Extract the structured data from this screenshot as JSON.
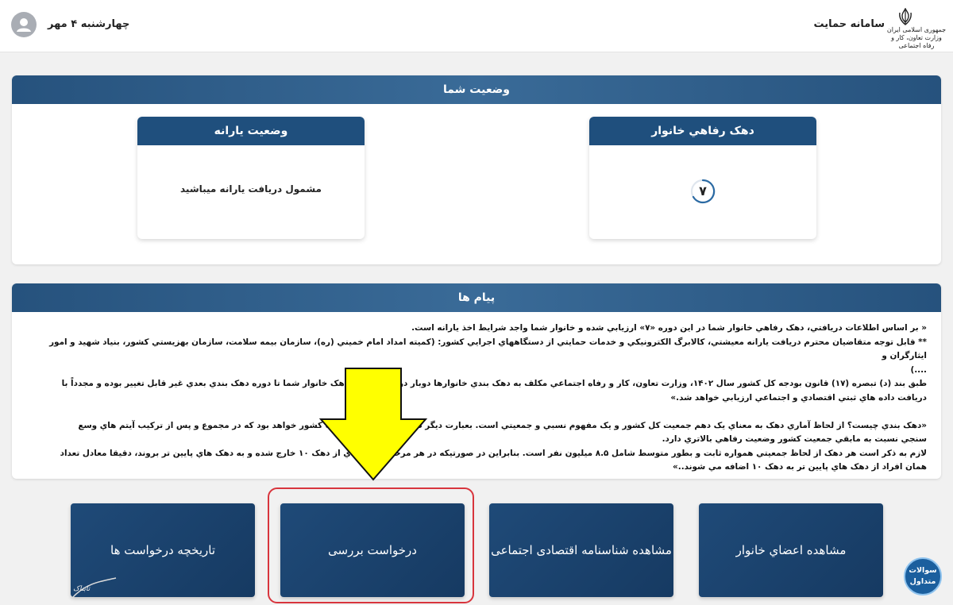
{
  "header": {
    "app_title": "سامانه حمايت",
    "ministry_lines": [
      "جمهوری اسلامی ایران",
      "وزارت تعاون، کار و رفاه اجتماعی"
    ],
    "date": "چهارشنبه ۴ مهر"
  },
  "status_panel": {
    "title": "وضعيت شما",
    "decile_card": {
      "title": "دهک رفاهي خانوار",
      "value": "۷"
    },
    "subsidy_card": {
      "title": "وضعيت يارانه",
      "text": "مشمول دريافت يارانه ميباشيد"
    }
  },
  "messages_panel": {
    "title": "پيام ها",
    "lines": [
      "« بر اساس اطلاعات دريافتي، دهک رفاهي خانوار شما در اين دوره «۷» ارزيابي شده و خانوار شما واجد شرايط اخذ يارانه است.",
      "** قابل توجه متقاضيان محترم دريافت يارانه معيشتي، کالابرگ الکترونيکي و خدمات حمايتي از دستگاههاي اجرايي کشور: (کميته امداد امام خميني (ره)، سازمان بيمه سلامت، سازمان بهزيستي کشور، بنياد شهيد و امور ايثارگران و",
      "....)",
      "طبق بند (د) تبصره (۱۷) قانون بودجه کل کشور سال ۱۴۰۲، وزارت تعاون، کار و رفاه اجتماعي مکلف به دهک بندي خانوارها دوبار در سال ... لذا دهک خانوار شما تا دوره دهک بندي بعدي غير قابل تغيير بوده و مجدداً با",
      "دريافت داده هاي ثبتي اقتصادي و اجتماعي ارزيابي خواهد شد.»",
      "",
      "«دهک بندي چيست؟ از لحاظ آماري دهک به معناي يک دهم جمعيت کل کشور و يک مفهوم نسبي و جمعيتي است. بعبارت ديگر دهک ... درصد از جمعيت کشور خواهد بود که در مجموع و پس از ترکيب آيتم هاي وسع",
      "سنجي نسبت به مابقي جمعيت کشور وضعيت رفاهي بالاتري دارد.",
      "لازم به ذکر است هر دهک از لحاظ جمعيتي همواره ثابت و بطور متوسط شامل ۸.۵ ميليون نفر است. بنابراين در صورتيکه در هر مرحله ... افرادي از دهک ۱۰ خارج شده و به دهک هاي پايين تر بروند، دقيقا معادل تعداد",
      "همان افراد از دهک هاي پايين تر به دهک ۱۰ اضافه مي شوند..»"
    ]
  },
  "tiles": {
    "members": "مشاهده اعضاي خانوار",
    "ident": "مشاهده شناسنامه اقتصادی اجتماعی",
    "review": "درخواست بررسی",
    "history": "تاریخچه درخواست ها"
  },
  "faq": {
    "line1": "سوالات",
    "line2": "متداول"
  },
  "watermark": "تابناک",
  "colors": {
    "header_blue": "#26527d",
    "tile_blue": "#1f4a78",
    "highlight_red": "#d8353d",
    "arrow_yellow": "#ffff00",
    "faq_blue": "#1b5f9e"
  }
}
